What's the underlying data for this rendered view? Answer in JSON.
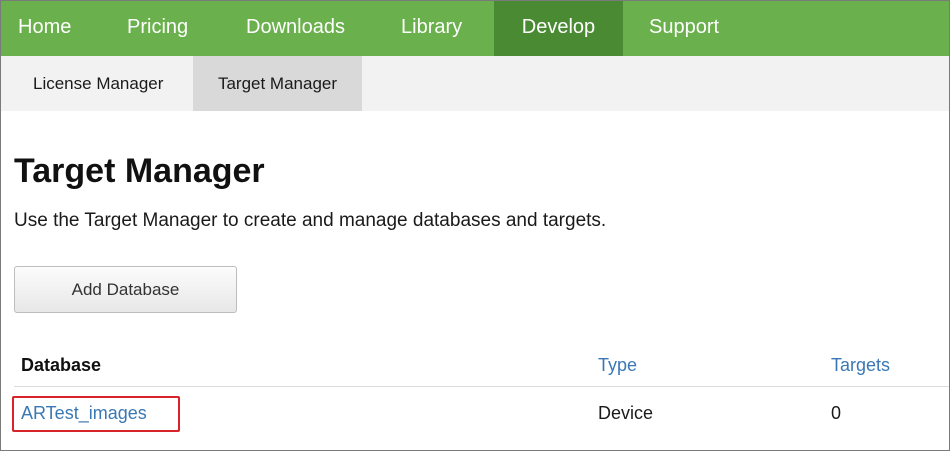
{
  "top_nav": {
    "items": [
      {
        "label": "Home"
      },
      {
        "label": "Pricing"
      },
      {
        "label": "Downloads"
      },
      {
        "label": "Library"
      },
      {
        "label": "Develop",
        "active": true
      },
      {
        "label": "Support"
      }
    ],
    "bg_color": "#6ab04c",
    "active_color": "#4a8a33"
  },
  "sub_nav": {
    "items": [
      {
        "label": "License Manager"
      },
      {
        "label": "Target Manager",
        "active": true
      }
    ]
  },
  "page": {
    "title": "Target Manager",
    "description": "Use the Target Manager to create and manage databases and targets.",
    "add_button_label": "Add Database"
  },
  "table": {
    "headers": {
      "database": "Database",
      "type": "Type",
      "targets": "Targets"
    },
    "rows": [
      {
        "database": "ARTest_images",
        "type": "Device",
        "targets": "0"
      }
    ]
  },
  "colors": {
    "link": "#3a78b5",
    "highlight_box": "#d9232a"
  }
}
